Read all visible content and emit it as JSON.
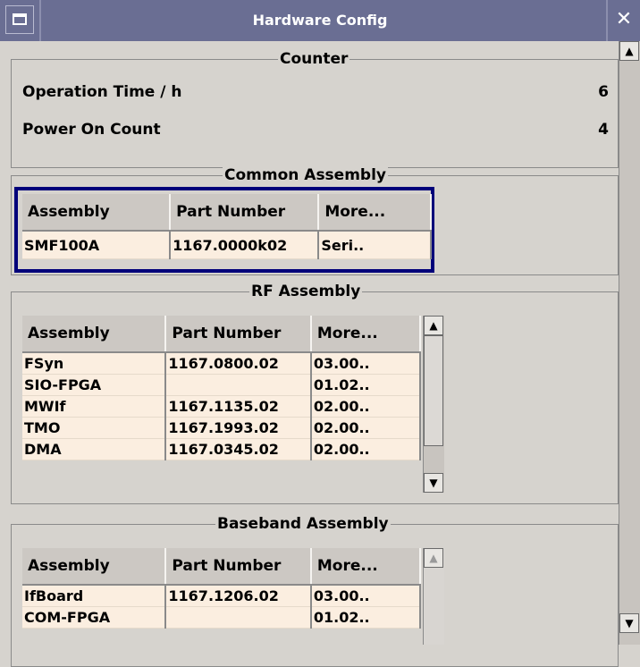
{
  "window": {
    "title": "Hardware Config",
    "close_glyph": "✕"
  },
  "counter": {
    "legend": "Counter",
    "rows": [
      {
        "label": "Operation Time / h",
        "value": "6"
      },
      {
        "label": "Power On Count",
        "value": "4"
      }
    ]
  },
  "common": {
    "legend": "Common Assembly",
    "headers": [
      "Assembly",
      "Part Number",
      "More..."
    ],
    "rows": [
      [
        "SMF100A",
        "1167.0000k02",
        "Seri.."
      ]
    ]
  },
  "rf": {
    "legend": "RF Assembly",
    "headers": [
      "Assembly",
      "Part Number",
      "More..."
    ],
    "rows": [
      [
        "FSyn",
        "1167.0800.02",
        "03.00.."
      ],
      [
        "SIO-FPGA",
        "",
        "01.02.."
      ],
      [
        "MWIf",
        "1167.1135.02",
        "02.00.."
      ],
      [
        "TMO",
        "1167.1993.02",
        "02.00.."
      ],
      [
        "DMA",
        "1167.0345.02",
        "02.00.."
      ]
    ]
  },
  "baseband": {
    "legend": "Baseband Assembly",
    "headers": [
      "Assembly",
      "Part Number",
      "More..."
    ],
    "rows": [
      [
        "IfBoard",
        "1167.1206.02",
        "03.00.."
      ],
      [
        "COM-FPGA",
        "",
        "01.02.."
      ]
    ]
  },
  "colors": {
    "titlebar": "#6a6e93",
    "selection": "#00007a",
    "cell_bg": "#fbeee0",
    "panel": "#d6d3ce"
  }
}
